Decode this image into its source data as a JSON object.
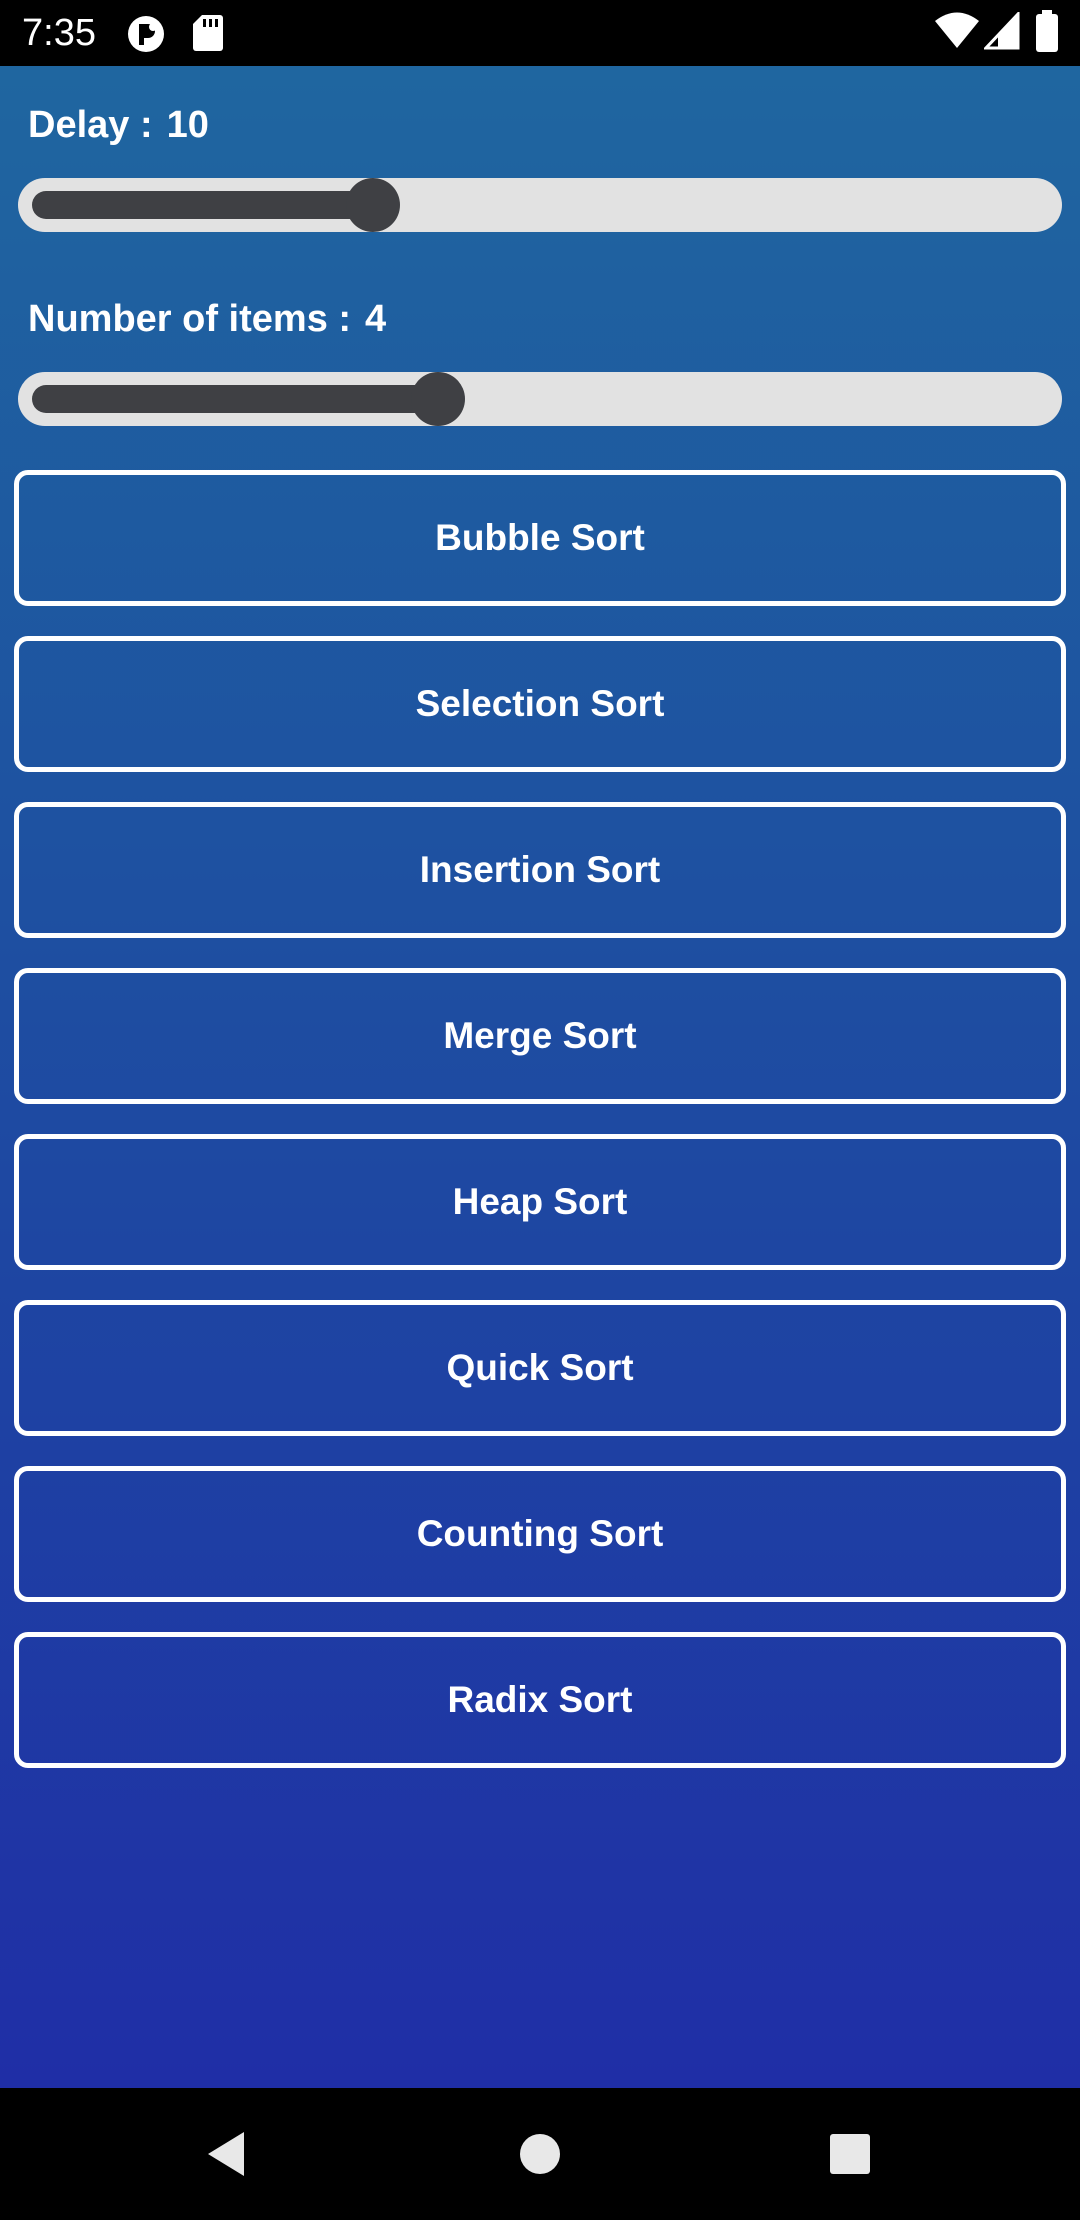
{
  "status_bar": {
    "time": "7:35",
    "icons_left": [
      "app-notification-icon",
      "sd-card-icon"
    ],
    "icons_right": [
      "wifi-icon",
      "cellular-signal-icon",
      "battery-icon"
    ]
  },
  "delay": {
    "label": "Delay :",
    "value": "10",
    "slider_fraction": 0.336
  },
  "items": {
    "label": "Number of items :",
    "value": "4",
    "slider_fraction": 0.4
  },
  "sort_buttons": [
    {
      "label": "Bubble Sort"
    },
    {
      "label": "Selection Sort"
    },
    {
      "label": "Insertion Sort"
    },
    {
      "label": "Merge Sort"
    },
    {
      "label": "Heap Sort"
    },
    {
      "label": "Quick Sort"
    },
    {
      "label": "Counting Sort"
    },
    {
      "label": "Radix Sort"
    }
  ],
  "nav_bar": {
    "icons": [
      "back-icon",
      "home-icon",
      "recents-icon"
    ]
  },
  "colors": {
    "slider_track": "#e2e2e2",
    "slider_active": "#3f4044",
    "button_border": "#ffffff",
    "background_top": "#1f66a0",
    "background_bottom": "#1f2ea6"
  }
}
